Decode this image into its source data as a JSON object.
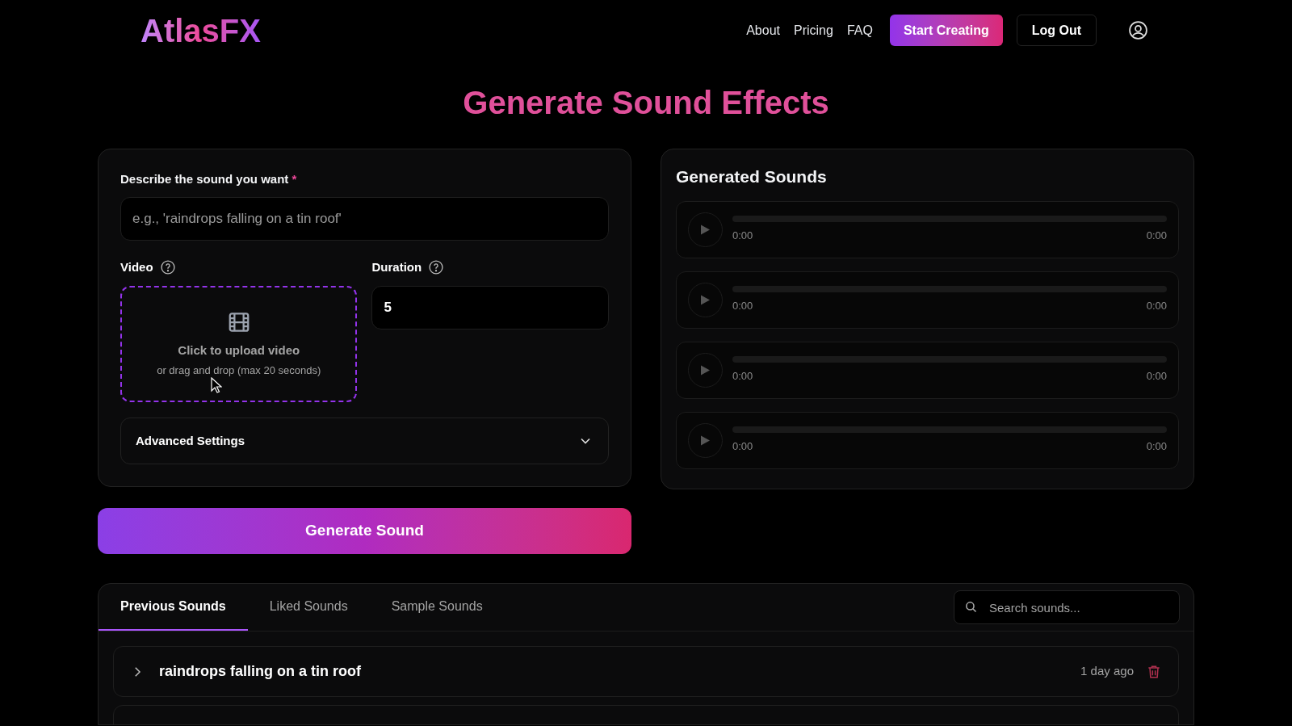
{
  "header": {
    "logo": "AtlasFX",
    "nav": [
      {
        "label": "About"
      },
      {
        "label": "Pricing"
      },
      {
        "label": "FAQ"
      }
    ],
    "primary_button": "Start Creating",
    "logout_button": "Log Out"
  },
  "title": "Generate Sound Effects",
  "form": {
    "prompt_label": "Describe the sound you want",
    "required_mark": "*",
    "prompt_placeholder": "e.g., 'raindrops falling on a tin roof'",
    "video_label": "Video",
    "upload_title": "Click to upload video",
    "upload_hint": "or drag and drop (max 20 seconds)",
    "duration_label": "Duration",
    "duration_value": "5",
    "advanced_label": "Advanced Settings",
    "advanced_expanded": false
  },
  "generate_button": "Generate Sound",
  "generated": {
    "title": "Generated Sounds",
    "players": [
      {
        "current": "0:00",
        "total": "0:00"
      },
      {
        "current": "0:00",
        "total": "0:00"
      },
      {
        "current": "0:00",
        "total": "0:00"
      },
      {
        "current": "0:00",
        "total": "0:00"
      }
    ]
  },
  "history": {
    "tabs": [
      {
        "label": "Previous Sounds",
        "selected": true
      },
      {
        "label": "Liked Sounds",
        "selected": false
      },
      {
        "label": "Sample Sounds",
        "selected": false
      }
    ],
    "search_placeholder": "Search sounds...",
    "items": [
      {
        "title": "raindrops falling on a tin roof",
        "time": "1 day ago",
        "expanded": false
      }
    ]
  }
}
